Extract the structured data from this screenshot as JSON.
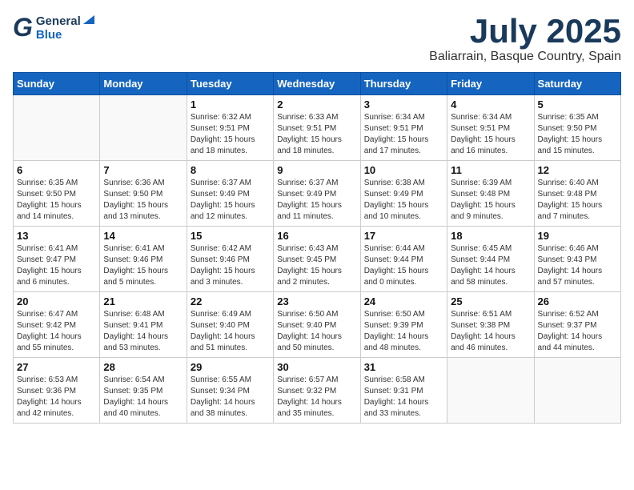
{
  "header": {
    "logo_general": "General",
    "logo_blue": "Blue",
    "month": "July 2025",
    "location": "Baliarrain, Basque Country, Spain"
  },
  "weekdays": [
    "Sunday",
    "Monday",
    "Tuesday",
    "Wednesday",
    "Thursday",
    "Friday",
    "Saturday"
  ],
  "weeks": [
    [
      {
        "day": "",
        "sunrise": "",
        "sunset": "",
        "daylight": "",
        "empty": true
      },
      {
        "day": "",
        "sunrise": "",
        "sunset": "",
        "daylight": "",
        "empty": true
      },
      {
        "day": "1",
        "sunrise": "Sunrise: 6:32 AM",
        "sunset": "Sunset: 9:51 PM",
        "daylight": "Daylight: 15 hours and 18 minutes.",
        "empty": false
      },
      {
        "day": "2",
        "sunrise": "Sunrise: 6:33 AM",
        "sunset": "Sunset: 9:51 PM",
        "daylight": "Daylight: 15 hours and 18 minutes.",
        "empty": false
      },
      {
        "day": "3",
        "sunrise": "Sunrise: 6:34 AM",
        "sunset": "Sunset: 9:51 PM",
        "daylight": "Daylight: 15 hours and 17 minutes.",
        "empty": false
      },
      {
        "day": "4",
        "sunrise": "Sunrise: 6:34 AM",
        "sunset": "Sunset: 9:51 PM",
        "daylight": "Daylight: 15 hours and 16 minutes.",
        "empty": false
      },
      {
        "day": "5",
        "sunrise": "Sunrise: 6:35 AM",
        "sunset": "Sunset: 9:50 PM",
        "daylight": "Daylight: 15 hours and 15 minutes.",
        "empty": false
      }
    ],
    [
      {
        "day": "6",
        "sunrise": "Sunrise: 6:35 AM",
        "sunset": "Sunset: 9:50 PM",
        "daylight": "Daylight: 15 hours and 14 minutes.",
        "empty": false
      },
      {
        "day": "7",
        "sunrise": "Sunrise: 6:36 AM",
        "sunset": "Sunset: 9:50 PM",
        "daylight": "Daylight: 15 hours and 13 minutes.",
        "empty": false
      },
      {
        "day": "8",
        "sunrise": "Sunrise: 6:37 AM",
        "sunset": "Sunset: 9:49 PM",
        "daylight": "Daylight: 15 hours and 12 minutes.",
        "empty": false
      },
      {
        "day": "9",
        "sunrise": "Sunrise: 6:37 AM",
        "sunset": "Sunset: 9:49 PM",
        "daylight": "Daylight: 15 hours and 11 minutes.",
        "empty": false
      },
      {
        "day": "10",
        "sunrise": "Sunrise: 6:38 AM",
        "sunset": "Sunset: 9:49 PM",
        "daylight": "Daylight: 15 hours and 10 minutes.",
        "empty": false
      },
      {
        "day": "11",
        "sunrise": "Sunrise: 6:39 AM",
        "sunset": "Sunset: 9:48 PM",
        "daylight": "Daylight: 15 hours and 9 minutes.",
        "empty": false
      },
      {
        "day": "12",
        "sunrise": "Sunrise: 6:40 AM",
        "sunset": "Sunset: 9:48 PM",
        "daylight": "Daylight: 15 hours and 7 minutes.",
        "empty": false
      }
    ],
    [
      {
        "day": "13",
        "sunrise": "Sunrise: 6:41 AM",
        "sunset": "Sunset: 9:47 PM",
        "daylight": "Daylight: 15 hours and 6 minutes.",
        "empty": false
      },
      {
        "day": "14",
        "sunrise": "Sunrise: 6:41 AM",
        "sunset": "Sunset: 9:46 PM",
        "daylight": "Daylight: 15 hours and 5 minutes.",
        "empty": false
      },
      {
        "day": "15",
        "sunrise": "Sunrise: 6:42 AM",
        "sunset": "Sunset: 9:46 PM",
        "daylight": "Daylight: 15 hours and 3 minutes.",
        "empty": false
      },
      {
        "day": "16",
        "sunrise": "Sunrise: 6:43 AM",
        "sunset": "Sunset: 9:45 PM",
        "daylight": "Daylight: 15 hours and 2 minutes.",
        "empty": false
      },
      {
        "day": "17",
        "sunrise": "Sunrise: 6:44 AM",
        "sunset": "Sunset: 9:44 PM",
        "daylight": "Daylight: 15 hours and 0 minutes.",
        "empty": false
      },
      {
        "day": "18",
        "sunrise": "Sunrise: 6:45 AM",
        "sunset": "Sunset: 9:44 PM",
        "daylight": "Daylight: 14 hours and 58 minutes.",
        "empty": false
      },
      {
        "day": "19",
        "sunrise": "Sunrise: 6:46 AM",
        "sunset": "Sunset: 9:43 PM",
        "daylight": "Daylight: 14 hours and 57 minutes.",
        "empty": false
      }
    ],
    [
      {
        "day": "20",
        "sunrise": "Sunrise: 6:47 AM",
        "sunset": "Sunset: 9:42 PM",
        "daylight": "Daylight: 14 hours and 55 minutes.",
        "empty": false
      },
      {
        "day": "21",
        "sunrise": "Sunrise: 6:48 AM",
        "sunset": "Sunset: 9:41 PM",
        "daylight": "Daylight: 14 hours and 53 minutes.",
        "empty": false
      },
      {
        "day": "22",
        "sunrise": "Sunrise: 6:49 AM",
        "sunset": "Sunset: 9:40 PM",
        "daylight": "Daylight: 14 hours and 51 minutes.",
        "empty": false
      },
      {
        "day": "23",
        "sunrise": "Sunrise: 6:50 AM",
        "sunset": "Sunset: 9:40 PM",
        "daylight": "Daylight: 14 hours and 50 minutes.",
        "empty": false
      },
      {
        "day": "24",
        "sunrise": "Sunrise: 6:50 AM",
        "sunset": "Sunset: 9:39 PM",
        "daylight": "Daylight: 14 hours and 48 minutes.",
        "empty": false
      },
      {
        "day": "25",
        "sunrise": "Sunrise: 6:51 AM",
        "sunset": "Sunset: 9:38 PM",
        "daylight": "Daylight: 14 hours and 46 minutes.",
        "empty": false
      },
      {
        "day": "26",
        "sunrise": "Sunrise: 6:52 AM",
        "sunset": "Sunset: 9:37 PM",
        "daylight": "Daylight: 14 hours and 44 minutes.",
        "empty": false
      }
    ],
    [
      {
        "day": "27",
        "sunrise": "Sunrise: 6:53 AM",
        "sunset": "Sunset: 9:36 PM",
        "daylight": "Daylight: 14 hours and 42 minutes.",
        "empty": false
      },
      {
        "day": "28",
        "sunrise": "Sunrise: 6:54 AM",
        "sunset": "Sunset: 9:35 PM",
        "daylight": "Daylight: 14 hours and 40 minutes.",
        "empty": false
      },
      {
        "day": "29",
        "sunrise": "Sunrise: 6:55 AM",
        "sunset": "Sunset: 9:34 PM",
        "daylight": "Daylight: 14 hours and 38 minutes.",
        "empty": false
      },
      {
        "day": "30",
        "sunrise": "Sunrise: 6:57 AM",
        "sunset": "Sunset: 9:32 PM",
        "daylight": "Daylight: 14 hours and 35 minutes.",
        "empty": false
      },
      {
        "day": "31",
        "sunrise": "Sunrise: 6:58 AM",
        "sunset": "Sunset: 9:31 PM",
        "daylight": "Daylight: 14 hours and 33 minutes.",
        "empty": false
      },
      {
        "day": "",
        "sunrise": "",
        "sunset": "",
        "daylight": "",
        "empty": true
      },
      {
        "day": "",
        "sunrise": "",
        "sunset": "",
        "daylight": "",
        "empty": true
      }
    ]
  ]
}
